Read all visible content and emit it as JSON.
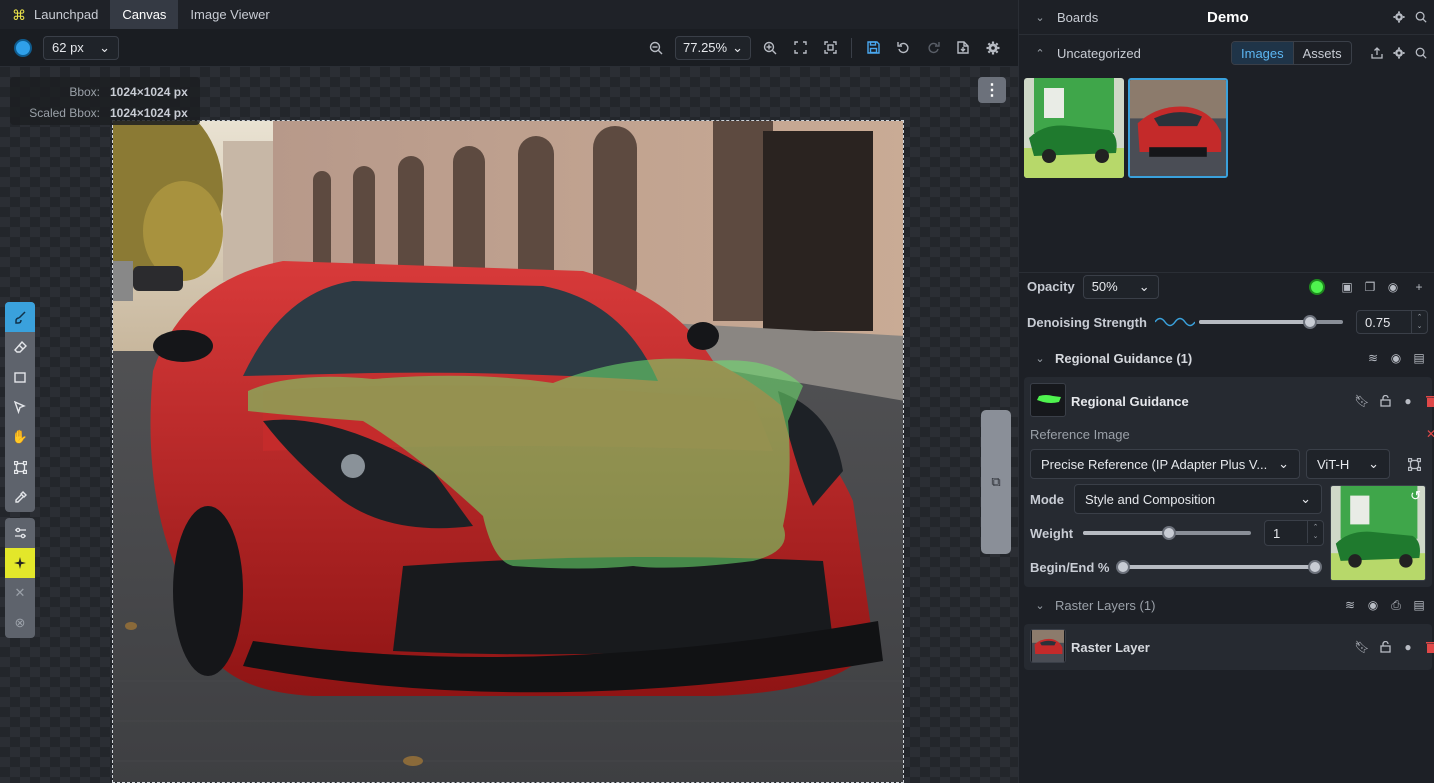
{
  "topbar": {
    "tabs": [
      {
        "label": "Launchpad"
      },
      {
        "label": "Canvas"
      },
      {
        "label": "Image Viewer"
      }
    ]
  },
  "toolbar": {
    "brush_color": "#2fa0ea",
    "brush_size": "62 px",
    "zoom": "77.25%"
  },
  "canvas": {
    "bbox_label": "Bbox:",
    "bbox_value": "1024×1024 px",
    "scaled_bbox_label": "Scaled Bbox:",
    "scaled_bbox_value": "1024×1024 px"
  },
  "right": {
    "boards_label": "Boards",
    "board_name": "Demo",
    "uncategorized_label": "Uncategorized",
    "images_tab": "Images",
    "assets_tab": "Assets",
    "opacity_label": "Opacity",
    "opacity_value": "50%",
    "fill_color": "#4ff34f",
    "denoise_label": "Denoising Strength",
    "denoise_value": "0.75",
    "regional_section": "Regional Guidance (1)",
    "regional_layer_name": "Regional Guidance",
    "reference_image_label": "Reference Image",
    "model_select": "Precise Reference (IP Adapter Plus V...",
    "clip_select": "ViT-H",
    "mode_label": "Mode",
    "mode_value": "Style and Composition",
    "weight_label": "Weight",
    "weight_value": "1",
    "begin_end_label": "Begin/End %",
    "raster_section": "Raster Layers (1)",
    "raster_layer_name": "Raster Layer"
  }
}
